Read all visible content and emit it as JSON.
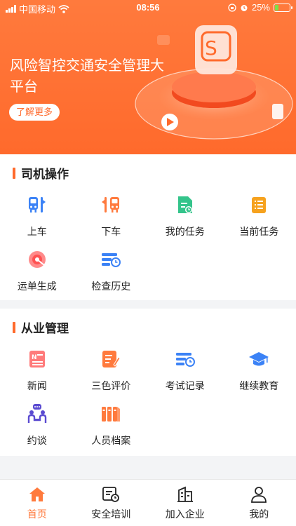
{
  "status_bar": {
    "carrier": "中国移动",
    "time": "08:56",
    "battery": "25%"
  },
  "banner": {
    "title": "风险智控交通安全管理大平台",
    "button_label": "了解更多"
  },
  "sections": [
    {
      "title": "司机操作",
      "items": [
        {
          "label": "上车",
          "icon": "bus-board-icon"
        },
        {
          "label": "下车",
          "icon": "bus-alight-icon"
        },
        {
          "label": "我的任务",
          "icon": "my-task-icon"
        },
        {
          "label": "当前任务",
          "icon": "current-task-icon"
        },
        {
          "label": "运单生成",
          "icon": "waybill-icon"
        },
        {
          "label": "检查历史",
          "icon": "inspection-history-icon"
        }
      ]
    },
    {
      "title": "从业管理",
      "items": [
        {
          "label": "新闻",
          "icon": "news-icon"
        },
        {
          "label": "三色评价",
          "icon": "rating-icon"
        },
        {
          "label": "考试记录",
          "icon": "exam-record-icon"
        },
        {
          "label": "继续教育",
          "icon": "education-cap-icon"
        },
        {
          "label": "约谈",
          "icon": "interview-icon"
        },
        {
          "label": "人员档案",
          "icon": "personnel-file-icon"
        }
      ]
    }
  ],
  "tabbar": {
    "tabs": [
      {
        "label": "首页",
        "icon": "home-icon",
        "active": true
      },
      {
        "label": "安全培训",
        "icon": "training-icon",
        "active": false
      },
      {
        "label": "加入企业",
        "icon": "building-icon",
        "active": false
      },
      {
        "label": "我的",
        "icon": "user-icon",
        "active": false
      }
    ]
  },
  "colors": {
    "accent": "#ff6a2c",
    "blue": "#3b82f6",
    "green": "#34c48b"
  }
}
